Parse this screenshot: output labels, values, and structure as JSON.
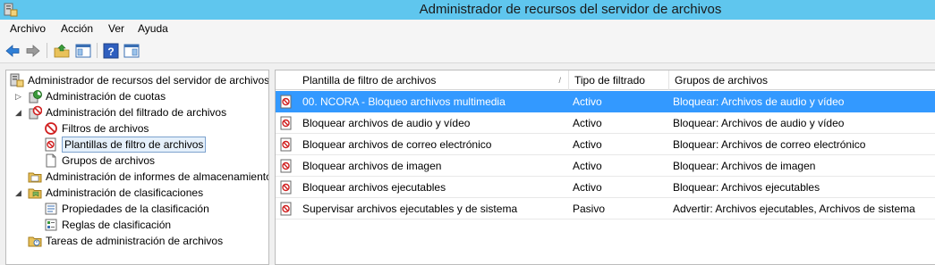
{
  "window": {
    "title": "Administrador de recursos del servidor de archivos"
  },
  "menu": [
    "Archivo",
    "Acción",
    "Ver",
    "Ayuda"
  ],
  "toolbar": {
    "icons": [
      "back-arrow-icon",
      "forward-arrow-icon",
      "up-folder-icon",
      "show-hide-tree-icon",
      "help-icon",
      "action-pane-icon"
    ]
  },
  "tree": [
    {
      "label": "Administrador de recursos del servidor de archivos",
      "icon": "server-icon",
      "level": 0,
      "expander": ""
    },
    {
      "label": "Administración de cuotas",
      "icon": "quota-icon",
      "level": 1,
      "expander": "collapsed"
    },
    {
      "label": "Administración del filtrado de archivos",
      "icon": "file-screen-icon",
      "level": 1,
      "expander": "expanded"
    },
    {
      "label": "Filtros de archivos",
      "icon": "file-filter-icon",
      "level": 2,
      "expander": ""
    },
    {
      "label": "Plantillas de filtro de archivos",
      "icon": "filter-template-icon",
      "level": 2,
      "expander": "",
      "selected": true
    },
    {
      "label": "Grupos de archivos",
      "icon": "file-group-icon",
      "level": 2,
      "expander": ""
    },
    {
      "label": "Administración de informes de almacenamiento",
      "icon": "reports-icon",
      "level": 1,
      "expander": ""
    },
    {
      "label": "Administración de clasificaciones",
      "icon": "classification-icon",
      "level": 1,
      "expander": "expanded"
    },
    {
      "label": "Propiedades de la clasificación",
      "icon": "properties-icon",
      "level": 2,
      "expander": ""
    },
    {
      "label": "Reglas de clasificación",
      "icon": "rules-icon",
      "level": 2,
      "expander": ""
    },
    {
      "label": "Tareas de administración de archivos",
      "icon": "tasks-icon",
      "level": 1,
      "expander": ""
    }
  ],
  "list": {
    "columns": [
      "Plantilla de filtro de archivos",
      "Tipo de filtrado",
      "Grupos de archivos"
    ],
    "rows": [
      {
        "name": "00. NCORA - Bloqueo archivos multimedia",
        "type": "Activo",
        "groups": "Bloquear: Archivos de audio y vídeo",
        "selected": true
      },
      {
        "name": "Bloquear archivos de audio y vídeo",
        "type": "Activo",
        "groups": "Bloquear: Archivos de audio y vídeo"
      },
      {
        "name": "Bloquear archivos de correo electrónico",
        "type": "Activo",
        "groups": "Bloquear: Archivos de correo electrónico"
      },
      {
        "name": "Bloquear archivos de imagen",
        "type": "Activo",
        "groups": "Bloquear: Archivos de imagen"
      },
      {
        "name": "Bloquear archivos ejecutables",
        "type": "Activo",
        "groups": "Bloquear: Archivos ejecutables"
      },
      {
        "name": "Supervisar archivos ejecutables y de sistema",
        "type": "Pasivo",
        "groups": "Advertir: Archivos ejecutables, Archivos de sistema"
      }
    ]
  },
  "colors": {
    "titlebar": "#5fc6ee",
    "selection": "#3399ff"
  }
}
